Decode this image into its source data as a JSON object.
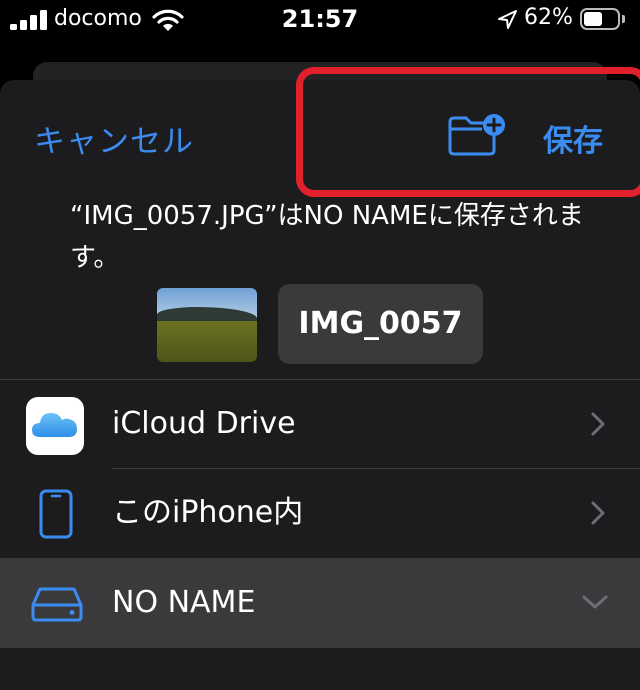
{
  "status_bar": {
    "carrier": "docomo",
    "time": "21:57",
    "battery_percent": "62%",
    "battery_level": 0.62,
    "signal_icon": "signal-bars-icon",
    "wifi_icon": "wifi-icon",
    "location_icon": "location-arrow-icon"
  },
  "sheet": {
    "cancel_label": "キャンセル",
    "save_label": "保存",
    "new_folder_icon": "new-folder-icon",
    "message": "“IMG_0057.JPG”はNO NAMEに保存されます。",
    "filename": "IMG_0057"
  },
  "locations": [
    {
      "label": "iCloud Drive",
      "icon": "icloud-icon",
      "disclosure": "chevron-right-icon"
    },
    {
      "label": "このiPhone内",
      "icon": "iphone-icon",
      "disclosure": "chevron-right-icon"
    },
    {
      "label": "NO NAME",
      "icon": "external-drive-icon",
      "disclosure": "chevron-down-icon",
      "selected": true
    }
  ],
  "colors": {
    "accent": "#3b8cf0",
    "highlight_annotation": "#e0202a",
    "sheet_background": "#1c1c1e",
    "selected_row": "#3a3a3c"
  }
}
